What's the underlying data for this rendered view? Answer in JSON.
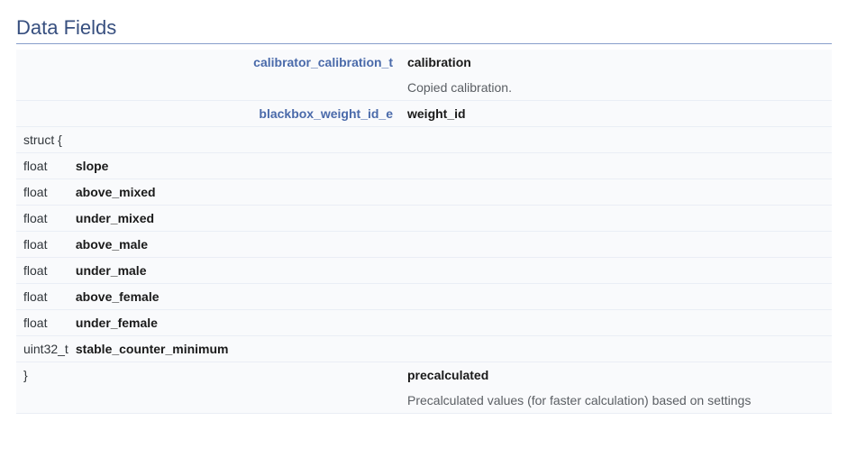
{
  "section_title": "Data Fields",
  "rows": [
    {
      "kind": "field",
      "type_text": "calibrator_calibration_t",
      "type_is_link": true,
      "name": "calibration"
    },
    {
      "kind": "desc",
      "text": "Copied calibration."
    },
    {
      "kind": "field",
      "type_text": "blackbox_weight_id_e",
      "type_is_link": true,
      "name": "weight_id"
    },
    {
      "kind": "struct_open",
      "text": "struct {"
    },
    {
      "kind": "subfield",
      "type_text": "float",
      "name": "slope"
    },
    {
      "kind": "subfield",
      "type_text": "float",
      "name": "above_mixed"
    },
    {
      "kind": "subfield",
      "type_text": "float",
      "name": "under_mixed"
    },
    {
      "kind": "subfield",
      "type_text": "float",
      "name": "above_male"
    },
    {
      "kind": "subfield",
      "type_text": "float",
      "name": "under_male"
    },
    {
      "kind": "subfield",
      "type_text": "float",
      "name": "above_female"
    },
    {
      "kind": "subfield",
      "type_text": "float",
      "name": "under_female"
    },
    {
      "kind": "subfield",
      "type_text": "uint32_t",
      "name": "stable_counter_minimum"
    },
    {
      "kind": "struct_close",
      "text": "}",
      "name": "precalculated"
    },
    {
      "kind": "desc",
      "text": "Precalculated values (for faster calculation) based on settings"
    }
  ]
}
